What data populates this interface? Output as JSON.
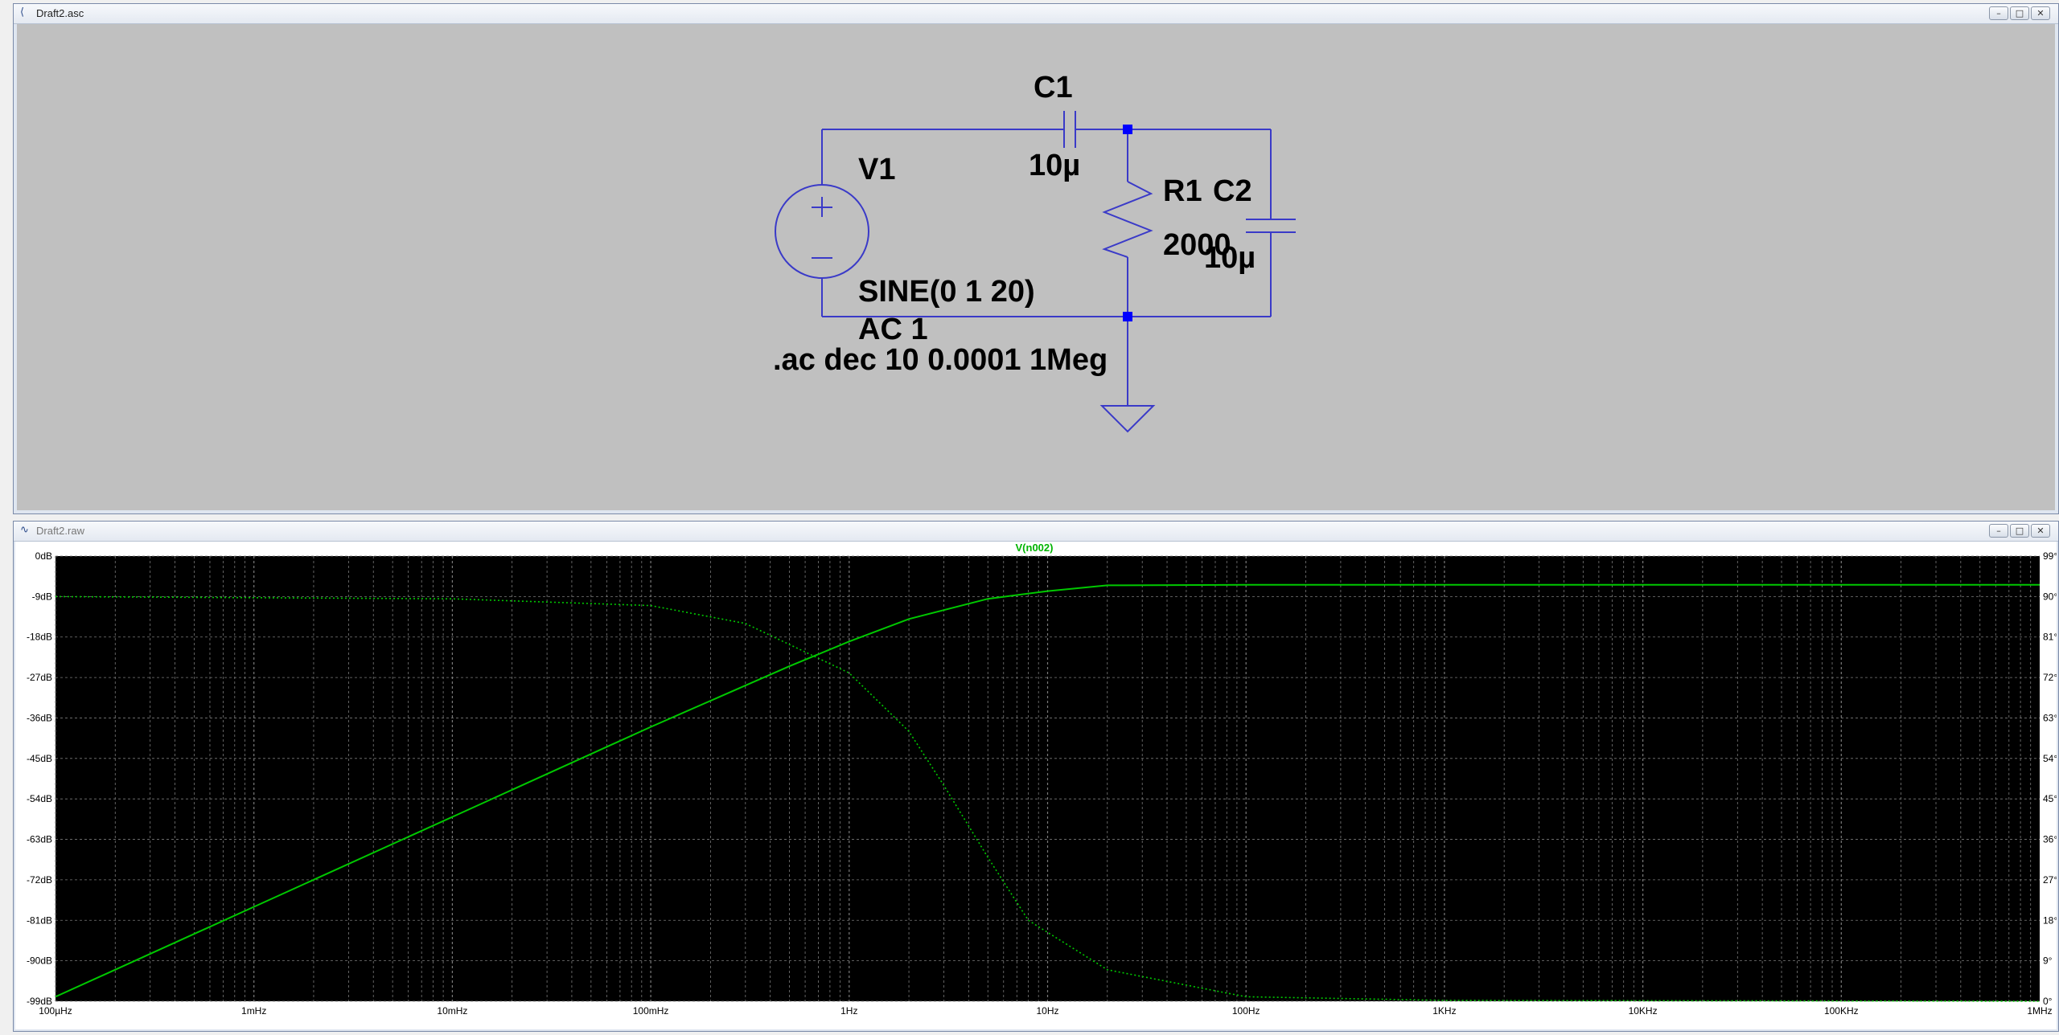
{
  "schematic_window": {
    "title": "Draft2.asc",
    "components": {
      "c1_name": "C1",
      "c1_value": "10µ",
      "v1_name": "V1",
      "v1_value": "SINE(0 1 20)",
      "v1_ac": "AC 1",
      "r1_name": "R1",
      "r1_value": "2000",
      "c2_name": "C2",
      "c2_value": "10µ"
    },
    "directive": ".ac dec 10 0.0001 1Meg",
    "colors": {
      "background": "#c0c0c0",
      "wire": "#3a3ac8",
      "junction": "#0000ff",
      "text": "#000000"
    }
  },
  "plot_window": {
    "title": "Draft2.raw",
    "trace_label": "V(n002)",
    "left_axis_labels": [
      "0dB",
      "-9dB",
      "-18dB",
      "-27dB",
      "-36dB",
      "-45dB",
      "-54dB",
      "-63dB",
      "-72dB",
      "-81dB",
      "-90dB",
      "-99dB"
    ],
    "right_axis_labels": [
      "99°",
      "90°",
      "81°",
      "72°",
      "63°",
      "54°",
      "45°",
      "36°",
      "27°",
      "18°",
      "9°",
      "0°"
    ],
    "x_axis_labels": [
      "100µHz",
      "1mHz",
      "10mHz",
      "100mHz",
      "1Hz",
      "10Hz",
      "100Hz",
      "1KHz",
      "10KHz",
      "100KHz",
      "1MHz"
    ],
    "colors": {
      "background": "#000000",
      "trace": "#00c800",
      "axis_text": "#000000",
      "label": "#00b400",
      "grid": "#7a7a7a"
    }
  },
  "chart_data": {
    "type": "line",
    "title": "V(n002)",
    "x_scale": "log",
    "xlim_hz": [
      0.0001,
      1000000
    ],
    "ylim_left_db": [
      -99,
      0
    ],
    "ylim_right_deg": [
      0,
      99
    ],
    "grid": true,
    "series": [
      {
        "name": "V(n002)",
        "style": "solid",
        "axis": "left",
        "x": [
          0.0001,
          0.001,
          0.01,
          0.1,
          0.5,
          1,
          2,
          5,
          10,
          20,
          100,
          1000,
          1000000
        ],
        "y": [
          -98,
          -78,
          -58,
          -38,
          -24.5,
          -19,
          -14,
          -9.5,
          -7.8,
          -6.5,
          -6.4,
          -6.4,
          -6.4
        ]
      },
      {
        "name": "V(n002)",
        "style": "dotted",
        "axis": "right",
        "x": [
          0.0001,
          0.01,
          0.1,
          0.3,
          1,
          2,
          3,
          5,
          8,
          20,
          100,
          1000,
          1000000
        ],
        "y": [
          90,
          89.5,
          88,
          84,
          73,
          60,
          48,
          32,
          18,
          7,
          1,
          0.2,
          0
        ]
      }
    ]
  }
}
